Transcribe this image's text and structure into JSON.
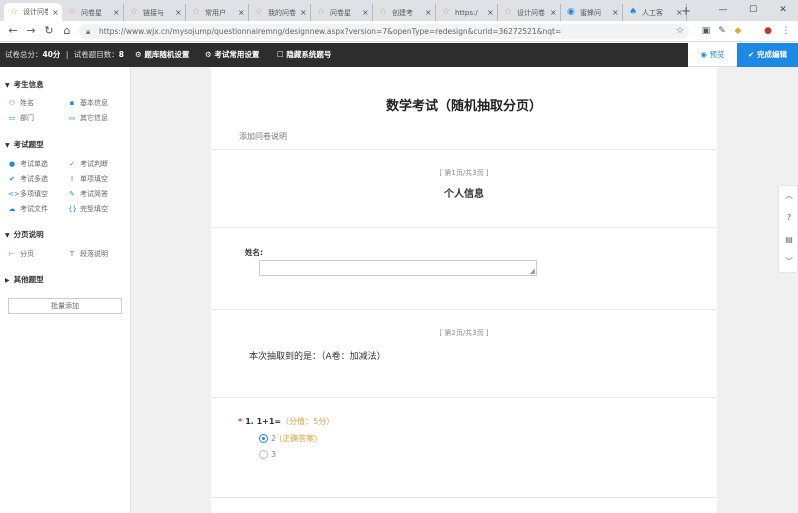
{
  "browser": {
    "tabs": [
      {
        "label": "设计问卷",
        "icon": "star-icon",
        "active": true
      },
      {
        "label": "问卷星",
        "icon": "star-icon"
      },
      {
        "label": "链接与",
        "icon": "star-icon"
      },
      {
        "label": "常用户",
        "icon": "star-icon"
      },
      {
        "label": "我的问卷",
        "icon": "star-icon"
      },
      {
        "label": "问卷星",
        "icon": "star-icon"
      },
      {
        "label": "创建考",
        "icon": "star-icon"
      },
      {
        "label": "https:/",
        "icon": "star-icon"
      },
      {
        "label": "设计问卷",
        "icon": "star-icon"
      },
      {
        "label": "蜜蜂问",
        "icon": "q-icon"
      },
      {
        "label": "人工客",
        "icon": "tooth-icon"
      }
    ],
    "url": "https://www.wjx.cn/mysojump/questionnairemng/designnew.aspx?version=7&openType=redesign&curid=36272521&nqt="
  },
  "appbar": {
    "total_score_label": "试卷总分：",
    "total_score": "40分",
    "separator": "|",
    "count_label": "试卷题目数：",
    "count": "8",
    "random_settings": "题库随机设置",
    "exam_settings": "考试常用设置",
    "hide_numbers": "隐藏系统题号",
    "preview": "预览",
    "finish": "完成编辑"
  },
  "sidebar": {
    "sections": [
      {
        "title": "考生信息",
        "items": [
          {
            "label": "姓名",
            "icon": "person-icon"
          },
          {
            "label": "基本信息",
            "icon": "id-card-icon"
          },
          {
            "label": "部门",
            "icon": "org-icon"
          },
          {
            "label": "其它信息",
            "icon": "card-icon"
          }
        ]
      },
      {
        "title": "考试题型",
        "items": [
          {
            "label": "考试单选",
            "icon": "radio-icon"
          },
          {
            "label": "考试判断",
            "icon": "check-icon"
          },
          {
            "label": "考试多选",
            "icon": "checkmark-icon"
          },
          {
            "label": "单项填空",
            "icon": "text-cursor-icon"
          },
          {
            "label": "多项填空",
            "icon": "brackets-icon"
          },
          {
            "label": "考试简答",
            "icon": "edit-icon"
          },
          {
            "label": "考试文件",
            "icon": "cloud-upload-icon"
          },
          {
            "label": "完型填空",
            "icon": "cloze-icon"
          }
        ]
      },
      {
        "title": "分页说明",
        "items": [
          {
            "label": "分页",
            "icon": "page-break-icon"
          },
          {
            "label": "段落说明",
            "icon": "paragraph-icon"
          }
        ]
      },
      {
        "title": "其他题型",
        "items": []
      }
    ],
    "batch_add": "批量添加"
  },
  "survey": {
    "title": "数学考试（随机抽取分页）",
    "description": "添加问卷说明",
    "page1_label": "[ 第1页/共3页 ]",
    "page1_title": "个人信息",
    "name_label": "姓名:",
    "page2_label": "[ 第2页/共3页 ]",
    "draw_text": "本次抽取到的是：（A卷：加减法）",
    "q1_required": "*",
    "q1_number": "1.",
    "q1_text": "1+1=",
    "q1_score": "（分值：5分）",
    "q1_option1": "2",
    "q1_option1_tag": "(正确答案)",
    "q1_option2": "3"
  },
  "colors": {
    "accent": "#1e88e5",
    "appbar_bg": "#2d2d2d",
    "score": "#e6a23c"
  }
}
